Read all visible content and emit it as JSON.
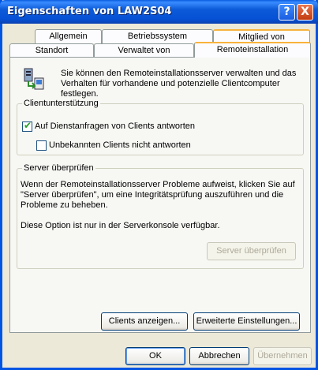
{
  "window": {
    "title": "Eigenschaften von LAW2S04"
  },
  "titlebar_buttons": {
    "help": "?",
    "close": "X"
  },
  "tabs_row1": [
    "Allgemein",
    "Betriebssystem",
    "Mitglied von"
  ],
  "tabs_row2": [
    "Standort",
    "Verwaltet von",
    "Remoteinstallation"
  ],
  "intro_text": "Sie können den Remoteinstallationsserver verwalten und das Verhalten für vorhandene und potenzielle Clientcomputer festlegen.",
  "client_support": {
    "title": "Clientunterstützung",
    "respond_label": "Auf Dienstanfragen von Clients antworten",
    "respond_checked": true,
    "unknown_label": "Unbekannten Clients nicht antworten",
    "unknown_checked": false
  },
  "check_server": {
    "title": "Server überprüfen",
    "text": "Wenn der Remoteinstallationsserver Probleme aufweist, klicken Sie auf \"Server überprüfen\", um eine Integritätsprüfung auszuführen und die Probleme zu beheben.",
    "note": "Diese Option ist nur in der Serverkonsole verfügbar.",
    "button": "Server überprüfen"
  },
  "panel_buttons": {
    "show_clients": "Clients anzeigen...",
    "advanced": "Erweiterte Einstellungen..."
  },
  "dialog_buttons": {
    "ok": "OK",
    "cancel": "Abbrechen",
    "apply": "Übernehmen"
  },
  "icons": {
    "server": "server-network-icon",
    "check": "checkmark-icon"
  }
}
